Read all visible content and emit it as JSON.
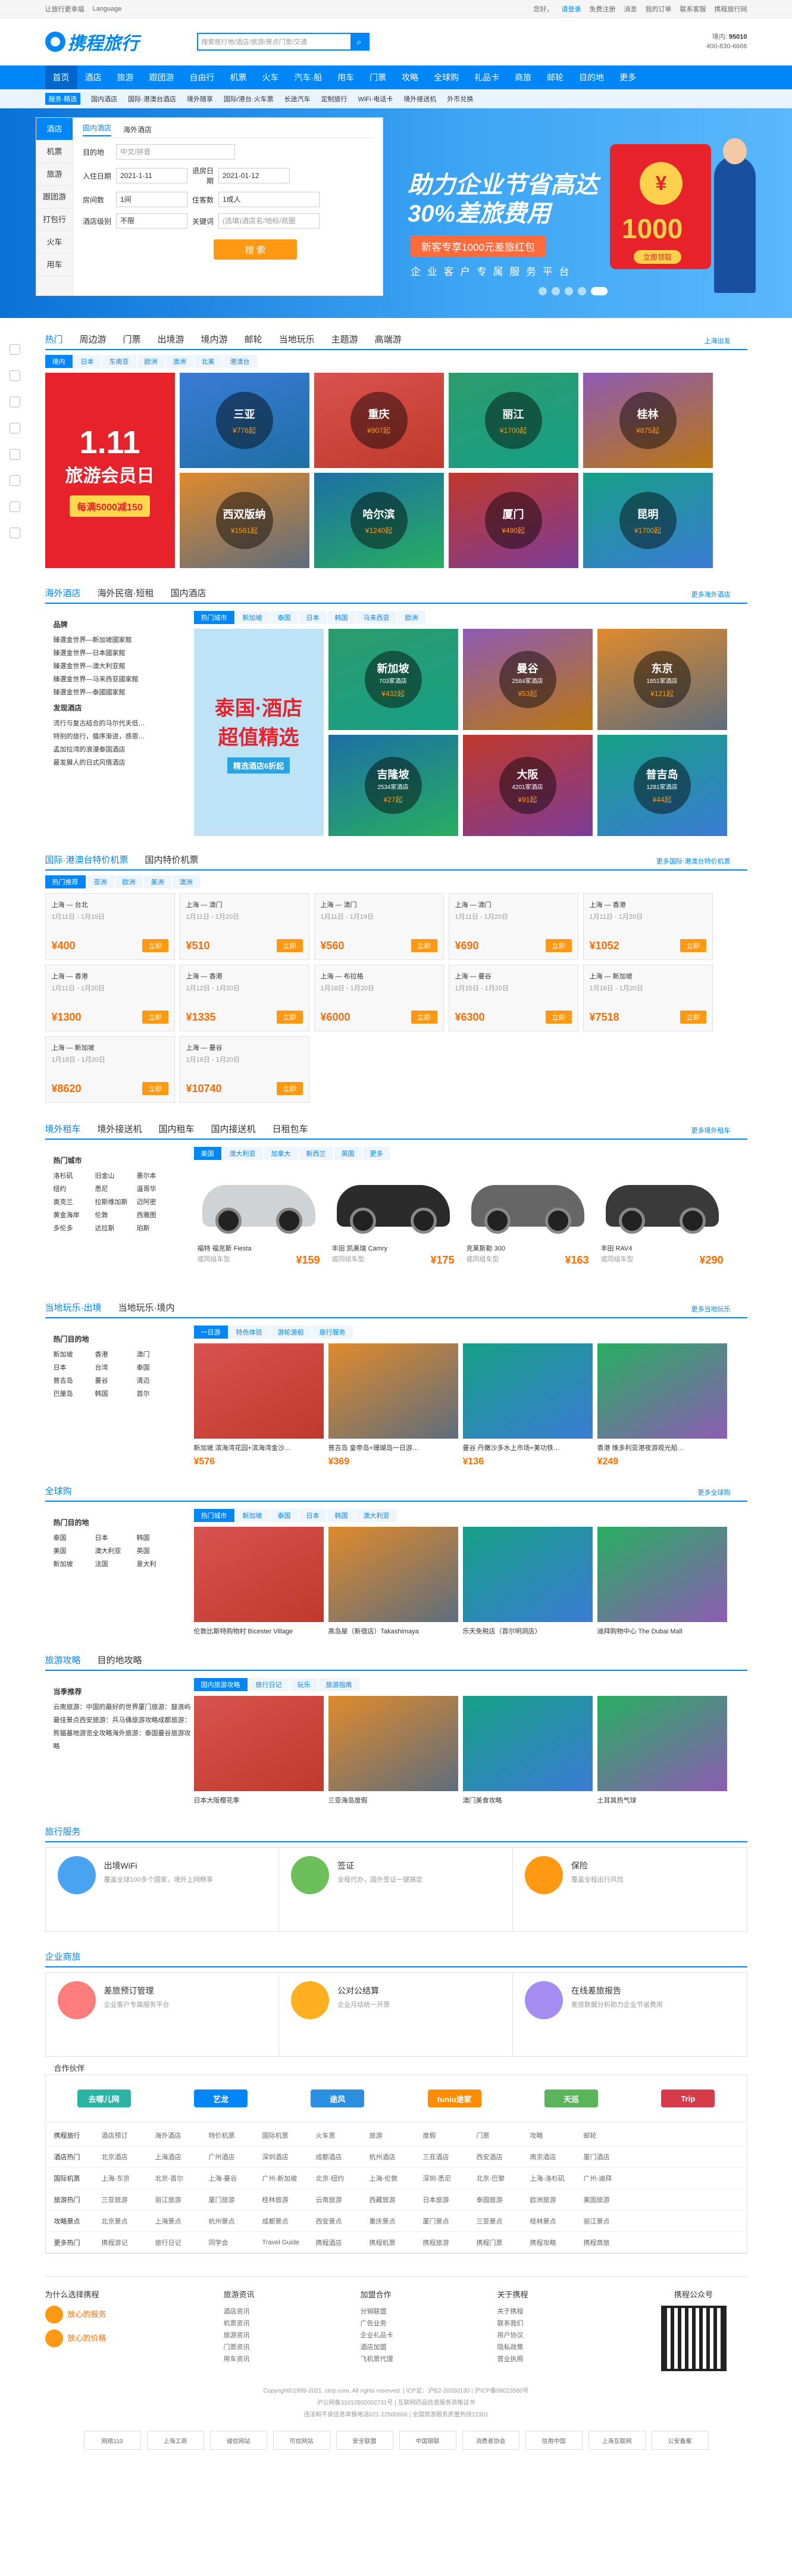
{
  "topbar": {
    "left": [
      "让旅行更幸福",
      "Language"
    ],
    "right": [
      "您好，",
      "请登录",
      "免费注册",
      "消息",
      "我的订单",
      "联系客服",
      "携程旅行网"
    ]
  },
  "header": {
    "logo": "携程旅行",
    "search_placeholder": "搜索旅行地/酒店/旅游/景点门票/交通",
    "hotline_label": "境内:",
    "hotline_num": "95010",
    "hotline2": "400-830-6666"
  },
  "nav": [
    "首页",
    "酒店",
    "旅游",
    "跟团游",
    "自由行",
    "机票",
    "火车",
    "汽车·船",
    "用车",
    "门票",
    "攻略",
    "全球购",
    "礼品卡",
    "商旅",
    "邮轮",
    "目的地",
    "更多"
  ],
  "subnav": {
    "tag": "服务·精选",
    "items": [
      "国内酒店",
      "国际·港澳台酒店",
      "境外随享",
      "国际/港台·火车票",
      "长途汽车",
      "定制旅行",
      "WiFi·电话卡",
      "境外接送机",
      "外币兑换"
    ]
  },
  "booking": {
    "side": [
      "酒店",
      "机票",
      "旅游",
      "跟团游",
      "打包行",
      "火车",
      "用车"
    ],
    "tabs": [
      "国内酒店",
      "海外酒店"
    ],
    "dest_label": "目的地",
    "dest_ph": "中文/拼音",
    "in_label": "入住日期",
    "in_val": "2021-1-11",
    "out_label": "退房日期",
    "out_val": "2021-01-12",
    "room_label": "房间数",
    "room_val": "1间",
    "guest_label": "住客数",
    "guest_val": "1成人",
    "star_label": "酒店级别",
    "star_val": "不限",
    "kw_label": "关键词",
    "kw_ph": "(选填)酒店名/地标/商圈",
    "search": "搜 索"
  },
  "banner": {
    "line1": "助力企业节省高达",
    "line2": "30%差旅费用",
    "btn": "新客专享1000元差旅红包",
    "line3": "企 业 客 户 专 属 服 务 平 台",
    "coin": "¥",
    "amount": "1000",
    "go": "立即领取"
  },
  "hot": {
    "tabs": [
      "热门",
      "周边游",
      "门票",
      "出境游",
      "境内游",
      "邮轮",
      "当地玩乐",
      "主题游",
      "高端游"
    ],
    "more": "上海出发",
    "cats": [
      "境内",
      "日本",
      "东南亚",
      "欧洲",
      "澳洲",
      "北美",
      "港澳台"
    ],
    "items": [
      {
        "n": "三亚",
        "p": "¥776起"
      },
      {
        "n": "重庆",
        "p": "¥907起"
      },
      {
        "n": "丽江",
        "p": "¥1700起"
      },
      {
        "n": "桂林",
        "p": "¥875起"
      },
      {
        "n": "西双版纳",
        "p": "¥1561起"
      },
      {
        "n": "哈尔滨",
        "p": "¥1240起"
      },
      {
        "n": "厦门",
        "p": "¥490起"
      },
      {
        "n": "昆明",
        "p": "¥1700起"
      }
    ],
    "promo": {
      "a": "1.11",
      "b": "旅游会员日",
      "c": "每满5000减150"
    }
  },
  "hotel": {
    "tabs": [
      "海外酒店",
      "海外民宿·短租",
      "国内酒店"
    ],
    "more": "更多海外酒店",
    "cats": [
      "热门城市",
      "新加坡",
      "泰国",
      "日本",
      "韩国",
      "马来西亚",
      "欧洲"
    ],
    "left_h1": "品牌",
    "left1": [
      "臻選金世界—新加坡國家館",
      "臻選金世界—日本國家館",
      "臻選金世界—澳大利亚館",
      "臻選金世界—马来西亚國家館",
      "臻選金世界—泰國國家館"
    ],
    "left_h2": "发现酒店",
    "left2": [
      "流行与复古结合的马尔代夫低…",
      "特别的旅行，循序渐进，感恩…",
      "孟加拉湾的浪漫泰国酒店",
      "最发展人的日式风情酒店"
    ],
    "items": [
      {
        "n": "新加坡",
        "c": "703家酒店",
        "p": "¥432起"
      },
      {
        "n": "曼谷",
        "c": "2584家酒店",
        "p": "¥53起"
      },
      {
        "n": "东京",
        "c": "1851家酒店",
        "p": "¥121起"
      },
      {
        "n": "吉隆坡",
        "c": "2534家酒店",
        "p": "¥27起"
      },
      {
        "n": "大阪",
        "c": "4201家酒店",
        "p": "¥91起"
      },
      {
        "n": "普吉岛",
        "c": "1281家酒店",
        "p": "¥44起"
      }
    ],
    "promo": {
      "a": "泰国·酒店",
      "b": "超值精选",
      "c": "精选酒店6折起"
    }
  },
  "flight": {
    "tabs": [
      "国际·港澳台特价机票",
      "国内特价机票"
    ],
    "more": "更多国际·港澳台特价机票",
    "cats": [
      "热门推荐",
      "亚洲",
      "欧洲",
      "美洲",
      "澳洲"
    ],
    "book": "立即",
    "items": [
      {
        "r": "上海 — 台北",
        "d": "1月11日 - 1月19日",
        "p": "¥400"
      },
      {
        "r": "上海 — 澳门",
        "d": "1月11日 - 1月20日",
        "p": "¥510"
      },
      {
        "r": "上海 — 澳门",
        "d": "1月11日 - 1月19日",
        "p": "¥560"
      },
      {
        "r": "上海 — 澳门",
        "d": "1月11日 - 1月20日",
        "p": "¥690"
      },
      {
        "r": "上海 — 香港",
        "d": "1月11日 - 1月20日",
        "p": "¥1052"
      },
      {
        "r": "上海 — 香港",
        "d": "1月11日 - 1月20日",
        "p": "¥1300"
      },
      {
        "r": "上海 — 香港",
        "d": "1月12日 - 1月20日",
        "p": "¥1335"
      },
      {
        "r": "上海 — 布拉格",
        "d": "1月18日 - 1月20日",
        "p": "¥6000"
      },
      {
        "r": "上海 — 曼谷",
        "d": "1月15日 - 1月20日",
        "p": "¥6300"
      },
      {
        "r": "上海 — 新加坡",
        "d": "1月16日 - 1月20日",
        "p": "¥7518"
      },
      {
        "r": "上海 — 新加坡",
        "d": "1月18日 - 1月20日",
        "p": "¥8620"
      },
      {
        "r": "上海 — 曼谷",
        "d": "1月16日 - 1月20日",
        "p": "¥10740"
      }
    ]
  },
  "car": {
    "tabs": [
      "境外租车",
      "境外接送机",
      "国内租车",
      "国内接送机",
      "日租包车"
    ],
    "more": "更多境外租车",
    "cats": [
      "美国",
      "澳大利亚",
      "加拿大",
      "新西兰",
      "英国",
      "更多"
    ],
    "left_h": "热门城市",
    "left": [
      "洛杉矶",
      "旧金山",
      "墨尔本",
      "纽约",
      "悉尼",
      "温哥华",
      "奥克兰",
      "拉斯维加斯",
      "迈阿密",
      "黄金海岸",
      "伦敦",
      "西雅图",
      "多伦多",
      "达拉斯",
      "珀斯"
    ],
    "items": [
      {
        "n": "福特 福克斯 Fiesta",
        "s": "或同组车型",
        "p": "¥159"
      },
      {
        "n": "丰田 凯美瑞 Camry",
        "s": "或同组车型",
        "p": "¥175"
      },
      {
        "n": "克莱斯勒 300",
        "s": "或同组车型",
        "p": "¥163"
      },
      {
        "n": "丰田 RAV4",
        "s": "或同组车型",
        "p": "¥290"
      }
    ]
  },
  "play": {
    "tabs": [
      "当地玩乐·出境",
      "当地玩乐·境内"
    ],
    "more": "更多当地玩乐",
    "cats": [
      "一日游",
      "特色体验",
      "游轮游船",
      "旅行服务"
    ],
    "left_h": "热门目的地",
    "left": [
      "新加坡",
      "香港",
      "澳门",
      "日本",
      "台湾",
      "泰国",
      "普吉岛",
      "曼谷",
      "清迈",
      "巴厘岛",
      "韩国",
      "首尔"
    ],
    "items": [
      {
        "t": "新加坡 滨海湾花园+滨海湾金沙…",
        "p": "¥576"
      },
      {
        "t": "普吉岛 皇帝岛+珊瑚岛一日游…",
        "p": "¥369"
      },
      {
        "t": "曼谷 丹嫩沙多水上市场+美功铁…",
        "p": "¥136"
      },
      {
        "t": "香港 维多利亚港夜游观光船…",
        "p": "¥249"
      }
    ]
  },
  "shop": {
    "tabs": [
      "全球购"
    ],
    "more": "更多全球购",
    "cats": [
      "热门城市",
      "新加坡",
      "泰国",
      "日本",
      "韩国",
      "澳大利亚"
    ],
    "left_h": "热门目的地",
    "left": [
      "泰国",
      "日本",
      "韩国",
      "美国",
      "澳大利亚",
      "英国",
      "新加坡",
      "法国",
      "意大利"
    ],
    "items": [
      {
        "t": "伦敦比斯特购物村 Bicester Village"
      },
      {
        "t": "高岛屋（新宿店）Takashimaya"
      },
      {
        "t": "乐天免税店（首尔明洞店）"
      },
      {
        "t": "迪拜购物中心 The Dubai Mall"
      }
    ]
  },
  "guide": {
    "tabs": [
      "旅游攻略",
      "目的地攻略"
    ],
    "cats": [
      "国内旅游攻略",
      "旅行日记",
      "玩乐",
      "旅游指南"
    ],
    "left_h": "当季推荐",
    "left": [
      "云南旅游：中国的最好的世界",
      "厦门旅游：鼓浪屿最佳景点",
      "西安旅游：兵马俑旅游攻略",
      "成都旅游：熊猫基地游览全攻略",
      "海外旅游：泰国曼谷旅游攻略"
    ],
    "items": [
      {
        "t": "日本大阪樱花季"
      },
      {
        "t": "三亚海岛度假"
      },
      {
        "t": "澳门美食攻略"
      },
      {
        "t": "土耳其热气球"
      }
    ]
  },
  "services": {
    "title": "旅行服务",
    "items": [
      {
        "h": "出境WiFi",
        "p": "覆盖全球100多个国家，境外上网畅享",
        "c": "#4aa3f0"
      },
      {
        "h": "签证",
        "p": "全程代办，国外签证一键搞定",
        "c": "#6cbf5a"
      },
      {
        "h": "保险",
        "p": "覆盖全程出行风险",
        "c": "#ff9913"
      }
    ]
  },
  "enterprise": {
    "title": "企业商旅",
    "items": [
      {
        "h": "差旅预订管理",
        "p": "企业客户专属服务平台",
        "c": "#ff7d7d"
      },
      {
        "h": "公对公结算",
        "p": "企业月结统一开票",
        "c": "#ffb020"
      },
      {
        "h": "在线差旅报告",
        "p": "差旅数据分析助力企业节省费用",
        "c": "#a48cf0"
      }
    ]
  },
  "partners": {
    "title": "合作伙伴",
    "items": [
      "去哪儿网",
      "艺龙",
      "途风",
      "tuniu途家",
      "天巡",
      "Trip"
    ]
  },
  "links": {
    "rows": [
      {
        "h": "携程旅行",
        "items": [
          "酒店预订",
          "海外酒店",
          "特价机票",
          "国际机票",
          "火车票",
          "旅游",
          "度假",
          "门票",
          "攻略",
          "邮轮"
        ]
      },
      {
        "h": "酒店热门",
        "items": [
          "北京酒店",
          "上海酒店",
          "广州酒店",
          "深圳酒店",
          "成都酒店",
          "杭州酒店",
          "三亚酒店",
          "西安酒店",
          "南京酒店",
          "厦门酒店"
        ]
      },
      {
        "h": "国际机票",
        "items": [
          "上海-东京",
          "北京-首尔",
          "上海-曼谷",
          "广州-新加坡",
          "北京-纽约",
          "上海-伦敦",
          "深圳-悉尼",
          "北京-巴黎",
          "上海-洛杉矶",
          "广州-迪拜"
        ]
      },
      {
        "h": "旅游热门",
        "items": [
          "三亚旅游",
          "丽江旅游",
          "厦门旅游",
          "桂林旅游",
          "云南旅游",
          "西藏旅游",
          "日本旅游",
          "泰国旅游",
          "欧洲旅游",
          "美国旅游"
        ]
      },
      {
        "h": "攻略景点",
        "items": [
          "北京景点",
          "上海景点",
          "杭州景点",
          "成都景点",
          "西安景点",
          "重庆景点",
          "厦门景点",
          "三亚景点",
          "桂林景点",
          "丽江景点"
        ]
      },
      {
        "h": "更多热门",
        "items": [
          "携程游记",
          "旅行日记",
          "同学会",
          "Travel Guide",
          "携程酒店",
          "携程机票",
          "携程旅游",
          "携程门票",
          "携程攻略",
          "携程商旅"
        ]
      }
    ]
  },
  "footer": {
    "col1_h": "为什么选择携程",
    "col1": [
      "放心的服务",
      "放心的价格"
    ],
    "col2_h": "旅游资讯",
    "col2": [
      "酒店资讯",
      "机票资讯",
      "旅游资讯",
      "门票资讯",
      "用车资讯"
    ],
    "col3_h": "加盟合作",
    "col3": [
      "分销联盟",
      "广告业务",
      "企业礼品卡",
      "酒店加盟",
      "飞机票代理"
    ],
    "col4_h": "关于携程",
    "col4": [
      "关于携程",
      "联系我们",
      "用户协议",
      "隐私政策",
      "营业执照"
    ],
    "qr_label": "携程公众号",
    "copy1": "Copyright©1999-2021, ctrip.com. All rights reserved. | ICP证：沪B2-20050130 | 沪ICP备08023580号",
    "copy2": "沪公网备31010502002731号 | 互联网药品信息服务资格证书",
    "copy3": "违法和不良信息举报电话021-22500666 | 全国旅游服务质量热线12301",
    "badges": [
      "网络110",
      "上海工商",
      "诚信网站",
      "可信网站",
      "安全联盟",
      "中国银联",
      "消费者协会",
      "信用中国",
      "上海互联网",
      "公安备案"
    ]
  }
}
